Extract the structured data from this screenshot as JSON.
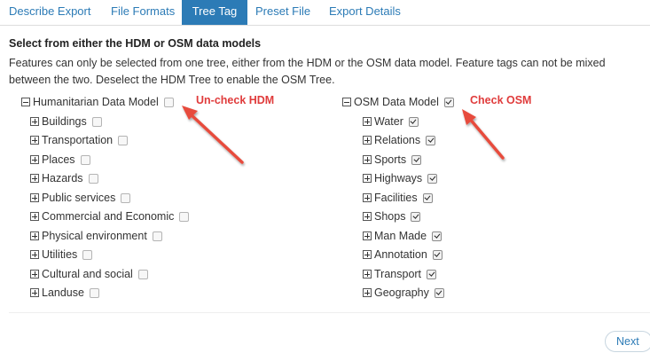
{
  "tabs": [
    {
      "label": "Describe Export"
    },
    {
      "label": "File Formats"
    },
    {
      "label": "Tree Tag"
    },
    {
      "label": "Preset File"
    },
    {
      "label": "Export Details"
    }
  ],
  "active_tab": "Tree Tag",
  "heading": "Select from either the HDM or OSM data models",
  "description": "Features can only be selected from one tree, either from the HDM or the OSM data model. Feature tags can not be mixed between the two. Deselect the HDM Tree to enable the OSM Tree.",
  "hdm": {
    "label": "Humanitarian Data Model",
    "checked": false,
    "items": [
      {
        "label": "Buildings",
        "checked": false
      },
      {
        "label": "Transportation",
        "checked": false
      },
      {
        "label": "Places",
        "checked": false
      },
      {
        "label": "Hazards",
        "checked": false
      },
      {
        "label": "Public services",
        "checked": false
      },
      {
        "label": "Commercial and Economic",
        "checked": false
      },
      {
        "label": "Physical environment",
        "checked": false
      },
      {
        "label": "Utilities",
        "checked": false
      },
      {
        "label": "Cultural and social",
        "checked": false
      },
      {
        "label": "Landuse",
        "checked": false
      }
    ]
  },
  "osm": {
    "label": "OSM Data Model",
    "checked": true,
    "items": [
      {
        "label": "Water",
        "checked": true
      },
      {
        "label": "Relations",
        "checked": true
      },
      {
        "label": "Sports",
        "checked": true
      },
      {
        "label": "Highways",
        "checked": true
      },
      {
        "label": "Facilities",
        "checked": true
      },
      {
        "label": "Shops",
        "checked": true
      },
      {
        "label": "Man Made",
        "checked": true
      },
      {
        "label": "Annotation",
        "checked": true
      },
      {
        "label": "Transport",
        "checked": true
      },
      {
        "label": "Geography",
        "checked": true
      }
    ]
  },
  "annotations": {
    "uncheck_hdm": "Un-check HDM",
    "check_osm": "Check OSM"
  },
  "footer": {
    "next_label": "Next"
  },
  "colors": {
    "accent": "#2c7bb6",
    "annotation": "#e03c3c"
  }
}
